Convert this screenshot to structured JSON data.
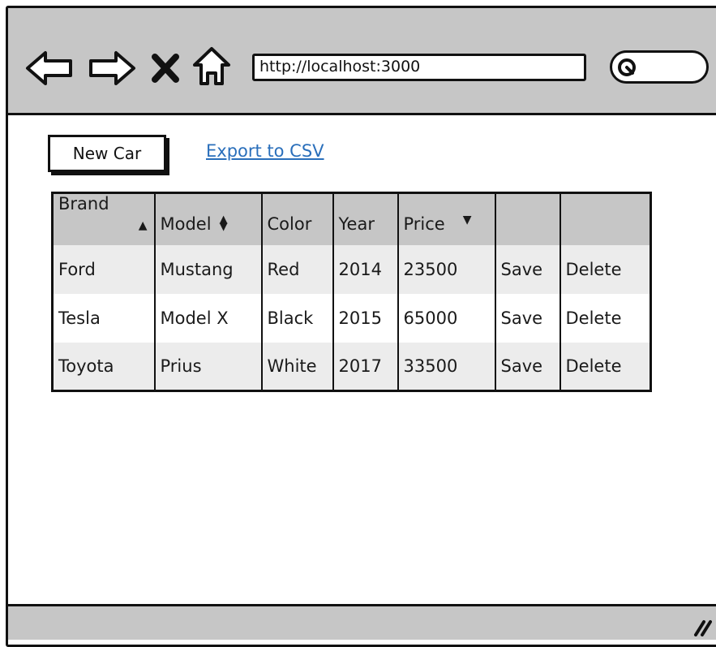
{
  "browser": {
    "url": "http://localhost:3000",
    "icons": {
      "back": "back-arrow-icon",
      "forward": "forward-arrow-icon",
      "stop": "close-icon",
      "home": "home-icon",
      "search": "search-icon"
    }
  },
  "toolbar": {
    "new_car_label": "New Car",
    "export_label": "Export to CSV"
  },
  "table": {
    "columns": [
      {
        "label": "Brand",
        "sort": "ascending"
      },
      {
        "label": "Model",
        "sort": "sortable"
      },
      {
        "label": "Color",
        "sort": ""
      },
      {
        "label": "Year",
        "sort": ""
      },
      {
        "label": "Price",
        "sort": "descending"
      },
      {
        "label": "",
        "sort": ""
      },
      {
        "label": "",
        "sort": ""
      }
    ],
    "rows": [
      {
        "brand": "Ford",
        "model": "Mustang",
        "color": "Red",
        "year": "2014",
        "price": "23500",
        "save": "Save",
        "delete": "Delete"
      },
      {
        "brand": "Tesla",
        "model": "Model X",
        "color": "Black",
        "year": "2015",
        "price": "65000",
        "save": "Save",
        "delete": "Delete"
      },
      {
        "brand": "Toyota",
        "model": "Prius",
        "color": "White",
        "year": "2017",
        "price": "33500",
        "save": "Save",
        "delete": "Delete"
      }
    ]
  },
  "colors": {
    "chrome": "#c6c6c6",
    "link": "#2a6fbb",
    "row_shaded": "#ececec"
  }
}
